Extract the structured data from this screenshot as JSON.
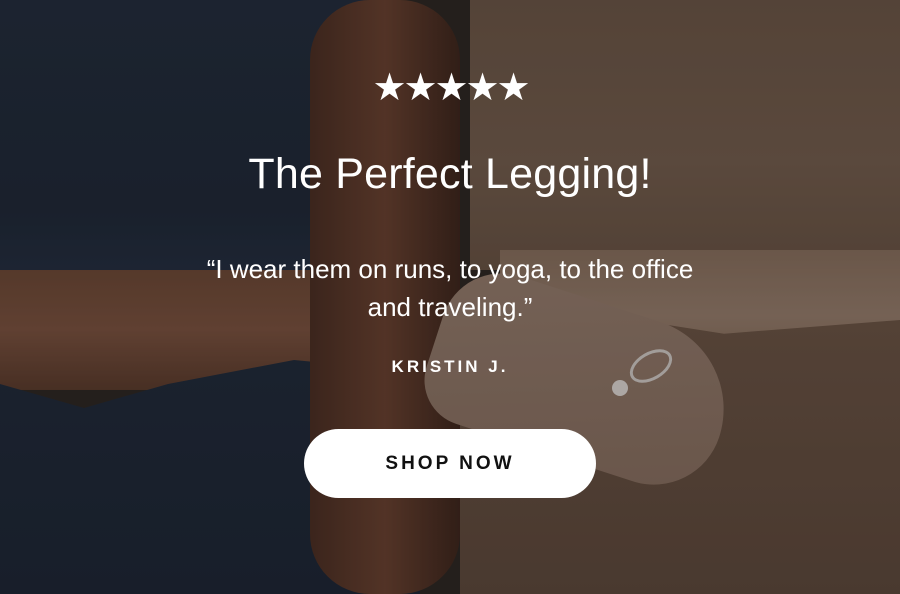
{
  "hero": {
    "rating_stars": [
      "★",
      "★",
      "★",
      "★",
      "★"
    ],
    "title": "The Perfect Legging!",
    "quote": "“I wear them on runs, to yoga, to the office and traveling.”",
    "author": "KRISTIN J.",
    "cta_label": "SHOP NOW"
  },
  "colors": {
    "text": "#ffffff",
    "button_bg": "#ffffff",
    "button_text": "#111111"
  }
}
